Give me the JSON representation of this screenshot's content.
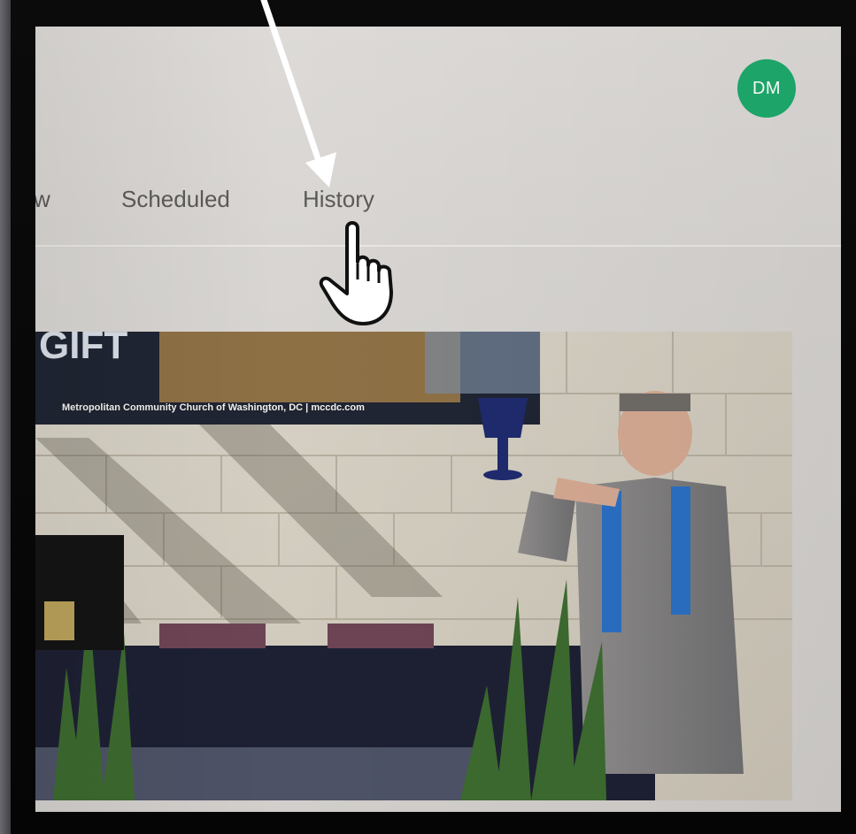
{
  "user": {
    "initials": "DM",
    "avatar_color": "#1eaa6c"
  },
  "tabs": {
    "partial": "w",
    "scheduled": "Scheduled",
    "history": "History"
  },
  "photo": {
    "banner_caption": "Metropolitan Community Church of Washington, DC | mccdc.com"
  },
  "icons": {
    "arrow": "arrow-down-icon",
    "cursor": "hand-pointer-icon"
  }
}
